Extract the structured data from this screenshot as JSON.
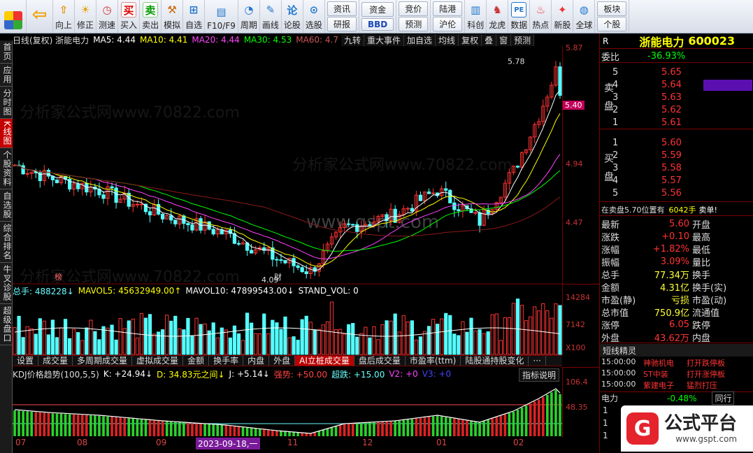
{
  "toolbar": {
    "buttons": [
      {
        "name": "up-button",
        "label": "向上",
        "icon": "arrow-up-icon"
      },
      {
        "name": "fix-button",
        "label": "修正",
        "icon": "fix-icon"
      },
      {
        "name": "test-button",
        "label": "测速",
        "icon": "clock-icon"
      },
      {
        "name": "buy-button",
        "label": "买入",
        "icon": "buy-icon"
      },
      {
        "name": "sell-button",
        "label": "卖出",
        "icon": "sell-icon"
      },
      {
        "name": "simulate-button",
        "label": "模拟",
        "icon": "hammer-icon"
      },
      {
        "name": "self-select-button",
        "label": "自选",
        "icon": "plus-icon"
      },
      {
        "name": "f10-button",
        "label": "F10/F9",
        "icon": "f10-icon"
      },
      {
        "name": "period-button",
        "label": "周期",
        "icon": "period-icon"
      },
      {
        "name": "draw-button",
        "label": "画线",
        "icon": "pencil-icon"
      },
      {
        "name": "stock-review-button",
        "label": "论股",
        "icon": "review-icon"
      },
      {
        "name": "select-stock-button",
        "label": "选股",
        "icon": "magnifier-icon"
      }
    ],
    "buy_glyph": "买",
    "sell_glyph": "卖",
    "review_glyph": "论",
    "group1": [
      "资讯",
      "研报"
    ],
    "group2": [
      "资金",
      "BBD"
    ],
    "group3": [
      "竞价",
      "预测"
    ],
    "group4": [
      "陆港",
      "沪伦"
    ],
    "buttons2": [
      {
        "name": "tech-button",
        "label": "科创",
        "icon": "chart-icon"
      },
      {
        "name": "dragon-tiger-button",
        "label": "龙虎",
        "icon": "dragon-icon"
      },
      {
        "name": "data-button",
        "label": "数据",
        "icon": "pe-icon"
      },
      {
        "name": "hot-button",
        "label": "热点",
        "icon": "hot-icon"
      },
      {
        "name": "new-stock-button",
        "label": "新股",
        "icon": "gift-icon"
      },
      {
        "name": "global-button",
        "label": "全球",
        "icon": "globe-icon"
      }
    ],
    "pe_glyph": "PE",
    "group5": [
      "板块",
      "个股"
    ]
  },
  "left_tabs": [
    "首页",
    "应用",
    "分时图",
    "K线图",
    "个股资料",
    "自选股",
    "综合排名",
    "牛叉诊股",
    "超级盘口"
  ],
  "left_active": "K线图",
  "kline": {
    "info": "日线(复权)  浙能电力",
    "ma5": "MA5: 4.44",
    "ma10": "MA10: 4.41",
    "ma20": "MA20: 4.44",
    "ma30": "MA30: 4.53",
    "ma60": "MA60: 4.7",
    "tabs": [
      "九转",
      "重大事件",
      "加自选",
      "均线",
      "复权",
      "叠",
      "窗",
      "预测"
    ],
    "axis": [
      "5.87",
      "5.40",
      "4.94",
      "4.47"
    ],
    "price_tag": "5.40",
    "high_label": "5.78",
    "low_label": "4.09",
    "mark_bang": "榜",
    "mark_cai": "财",
    "colors": {
      "up": "#ff3333",
      "down": "#54ffff",
      "ma5": "#ffffff",
      "ma10": "#ffff00",
      "ma20": "#ff44ff",
      "ma30": "#00ff00",
      "ma60": "#8b1a1a"
    }
  },
  "volume": {
    "info_total": "总手: 488228↓",
    "mavol5": "MAVOL5: 45632949.00↑",
    "mavol10": "MAVOL10: 47899543.00↓",
    "standvol": "STAND_VOL: 0",
    "axis": [
      "14284",
      "7142",
      "X100"
    ]
  },
  "bottom_tabs": [
    "设置",
    "成交量",
    "多周期成交量",
    "虚拟成交量",
    "金额",
    "换手率",
    "内盘",
    "外盘",
    "AI立桩成交量",
    "盘后成交量",
    "市盈率(ttm)",
    "陆股通持股变化",
    "···"
  ],
  "bottom_active": "AI立桩成交量",
  "kdj": {
    "info": "KDJ价格趋势(100,5,5)",
    "k": "K: +24.94↓",
    "d": "D: 34.83元之间↓",
    "j": "J: +5.14↓",
    "qiang": "强势: +50.00",
    "chao": "超跌: +15.00",
    "v2": "V2: +0",
    "v3": "V3: +0",
    "btn": "指标说明",
    "axis": [
      "106.4",
      "48.35"
    ]
  },
  "months": [
    "07",
    "08",
    "09",
    "11",
    "12",
    "01",
    "02"
  ],
  "date_tag": "2023-09-18,一",
  "right": {
    "name": "浙能电力",
    "code": "600023",
    "weibi_label": "委比",
    "weibi": "-36.93%",
    "sell_label": "卖盘",
    "buy_label": "买盘",
    "sell": [
      {
        "lv": "5",
        "p": "5.65",
        "v": ""
      },
      {
        "lv": "4",
        "p": "5.64",
        "v": ""
      },
      {
        "lv": "3",
        "p": "5.63",
        "v": ""
      },
      {
        "lv": "2",
        "p": "5.62",
        "v": ""
      },
      {
        "lv": "1",
        "p": "5.61",
        "v": ""
      }
    ],
    "buy": [
      {
        "lv": "1",
        "p": "5.60",
        "v": ""
      },
      {
        "lv": "2",
        "p": "5.59",
        "v": ""
      },
      {
        "lv": "3",
        "p": "5.58",
        "v": ""
      },
      {
        "lv": "4",
        "p": "5.57",
        "v": ""
      },
      {
        "lv": "5",
        "p": "5.56",
        "v": ""
      }
    ],
    "order_note": "在卖盘5.70位置有",
    "order_qty": "6042手",
    "order_tail": "卖单!",
    "stats": [
      {
        "l": "最新",
        "v": "5.60",
        "l2": "开盘",
        "c": "#ff3333"
      },
      {
        "l": "涨跌",
        "v": "+0.10",
        "l2": "最高",
        "c": "#ff3333"
      },
      {
        "l": "涨幅",
        "v": "+1.82%",
        "l2": "最低",
        "c": "#ff3333"
      },
      {
        "l": "振幅",
        "v": "3.09%",
        "l2": "量比",
        "c": "#ff3333"
      },
      {
        "l": "总手",
        "v": "77.34万",
        "l2": "换手",
        "c": "#ffff33"
      },
      {
        "l": "金额",
        "v": "4.31亿",
        "l2": "换手(实)",
        "c": "#ffff33"
      },
      {
        "l": "市盈(静)",
        "v": "亏损",
        "l2": "市盈(动)",
        "c": "#ffff33"
      },
      {
        "l": "总市值",
        "v": "750.9亿",
        "l2": "流通值",
        "c": "#ffff33"
      },
      {
        "l": "涨停",
        "v": "6.05",
        "l2": "跌停",
        "c": "#ff3333"
      },
      {
        "l": "外盘",
        "v": "43.62万",
        "l2": "内盘",
        "c": "#ff3333"
      }
    ],
    "short_title": "短线精灵",
    "short": [
      {
        "t": "15:00:00",
        "n": "神驰机电",
        "e": "打开跌停板"
      },
      {
        "t": "15:00:00",
        "n": "ST中装",
        "e": "打开涨停板"
      },
      {
        "t": "15:00:00",
        "n": "紫建电子",
        "e": "猛烈打压"
      }
    ],
    "bottom_name": "电力",
    "bottom_pct": "-0.48%",
    "bottom_tab": "同行",
    "bottom_rows": [
      "1",
      "1",
      "1"
    ]
  },
  "brand": {
    "text": "公式平台",
    "url": "www.gspt.com",
    "logo": "G"
  },
  "watermark1": "分析家公式网www.70822.com",
  "watermark2": "www.gspt.com"
}
